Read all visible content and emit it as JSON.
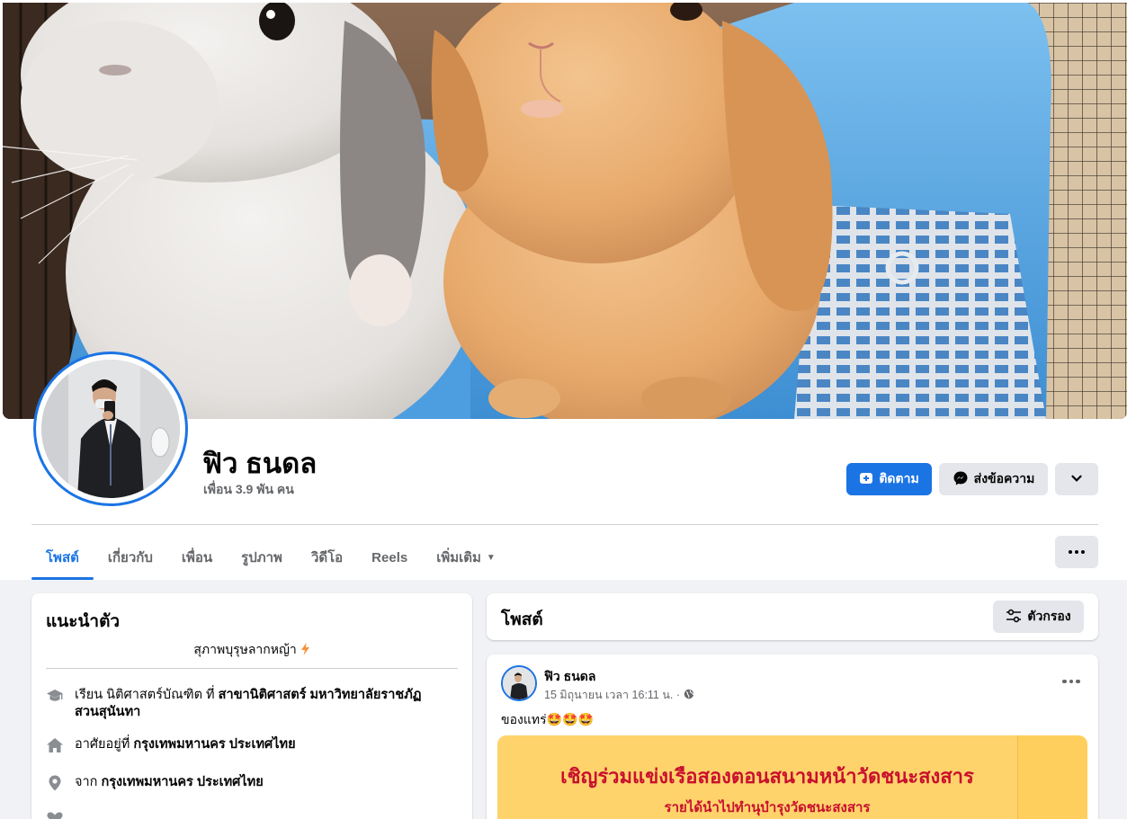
{
  "profile": {
    "name": "ฟิว ธนดล",
    "friends": "เพื่อน 3.9 พัน คน"
  },
  "actions": {
    "follow_label": "ติดตาม",
    "message_label": "ส่งข้อความ"
  },
  "tabs": [
    {
      "label": "โพสต์",
      "active": true
    },
    {
      "label": "เกี่ยวกับ"
    },
    {
      "label": "เพื่อน"
    },
    {
      "label": "รูปภาพ"
    },
    {
      "label": "วิดีโอ"
    },
    {
      "label": "Reels"
    },
    {
      "label": "เพิ่มเติม"
    }
  ],
  "intro": {
    "title": "แนะนำตัว",
    "bio": "สุภาพบุรุษลากหญ้า",
    "education": {
      "prefix": "เรียน นิติศาสตร์บัณฑิต ที่ ",
      "place": "สาขานิติศาสตร์ มหาวิทยาลัยราชภัฏสวนสุนันทา"
    },
    "lives": {
      "prefix": "อาศัยอยู่ที่ ",
      "place": "กรุงเทพมหานคร ประเทศไทย"
    },
    "from": {
      "prefix": "จาก ",
      "place": "กรุงเทพมหานคร ประเทศไทย"
    }
  },
  "posts_section": {
    "title": "โพสต์",
    "filter_label": "ตัวกรอง"
  },
  "post": {
    "author": "ฟิว ธนดล",
    "time": "15 มิถุนายน เวลา 16:11 น. ·",
    "text": "ของแทร่🤩🤩🤩",
    "image_line1": "เชิญร่วมแข่งเรือสองตอนสนามหน้าวัดชนะสงสาร",
    "image_line2": "รายได้นำไปทำนุบำรุงวัดชนะสงสาร"
  },
  "colors": {
    "accent": "#1b74e4",
    "page_bg": "#f0f2f5",
    "secondary_text": "#65676b",
    "button_gray": "#e4e6eb"
  },
  "icons": [
    "plus-user-icon",
    "messenger-icon",
    "chevron-down-icon",
    "more-dots-icon",
    "graduation-cap-icon",
    "home-icon",
    "location-pin-icon",
    "filter-sliders-icon",
    "globe-icon",
    "lightning-icon"
  ]
}
